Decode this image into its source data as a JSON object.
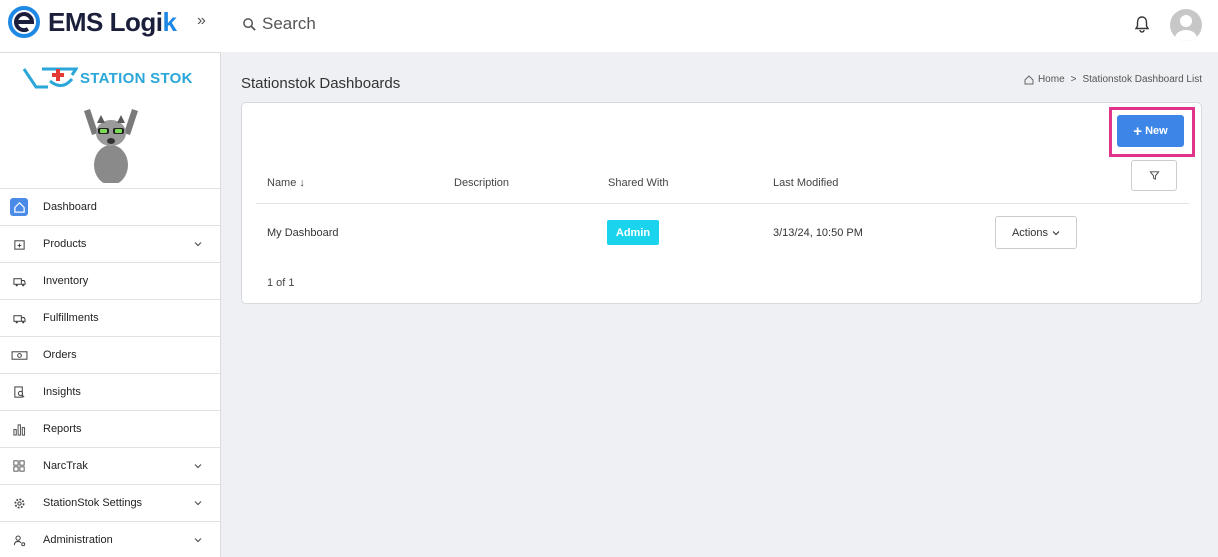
{
  "header": {
    "logo_text": "EMS Logi",
    "logo_k": "k",
    "expand_icon": "»",
    "search_placeholder": "Search"
  },
  "sidebar": {
    "brand": "STATION STOK",
    "items": [
      {
        "label": "Dashboard",
        "icon": "home-icon",
        "active": true
      },
      {
        "label": "Products",
        "icon": "box-icon",
        "has_chevron": true
      },
      {
        "label": "Inventory",
        "icon": "truck-icon"
      },
      {
        "label": "Fulfillments",
        "icon": "truck-icon"
      },
      {
        "label": "Orders",
        "icon": "money-icon"
      },
      {
        "label": "Insights",
        "icon": "report-search-icon"
      },
      {
        "label": "Reports",
        "icon": "bar-chart-icon"
      },
      {
        "label": "NarcTrak",
        "icon": "grid-icon",
        "has_chevron": true
      },
      {
        "label": "StationStok Settings",
        "icon": "gear-icon",
        "has_chevron": true
      },
      {
        "label": "Administration",
        "icon": "user-admin-icon",
        "has_chevron": true
      }
    ]
  },
  "main": {
    "title": "Stationstok Dashboards",
    "breadcrumb": {
      "home": "Home",
      "separator": ">",
      "current": "Stationstok Dashboard List"
    },
    "new_button": "New",
    "columns": {
      "name": "Name ↓",
      "description": "Description",
      "shared_with": "Shared With",
      "last_modified": "Last Modified"
    },
    "rows": [
      {
        "name": "My Dashboard",
        "description": "",
        "shared_with": "Admin",
        "last_modified": "3/13/24, 10:50 PM",
        "actions": "Actions"
      }
    ],
    "pagination": "1 of 1"
  },
  "colors": {
    "primary": "#3d85e6",
    "badge": "#1ad4ee",
    "highlight": "#e0338a",
    "brand": "#2aa6d8"
  }
}
